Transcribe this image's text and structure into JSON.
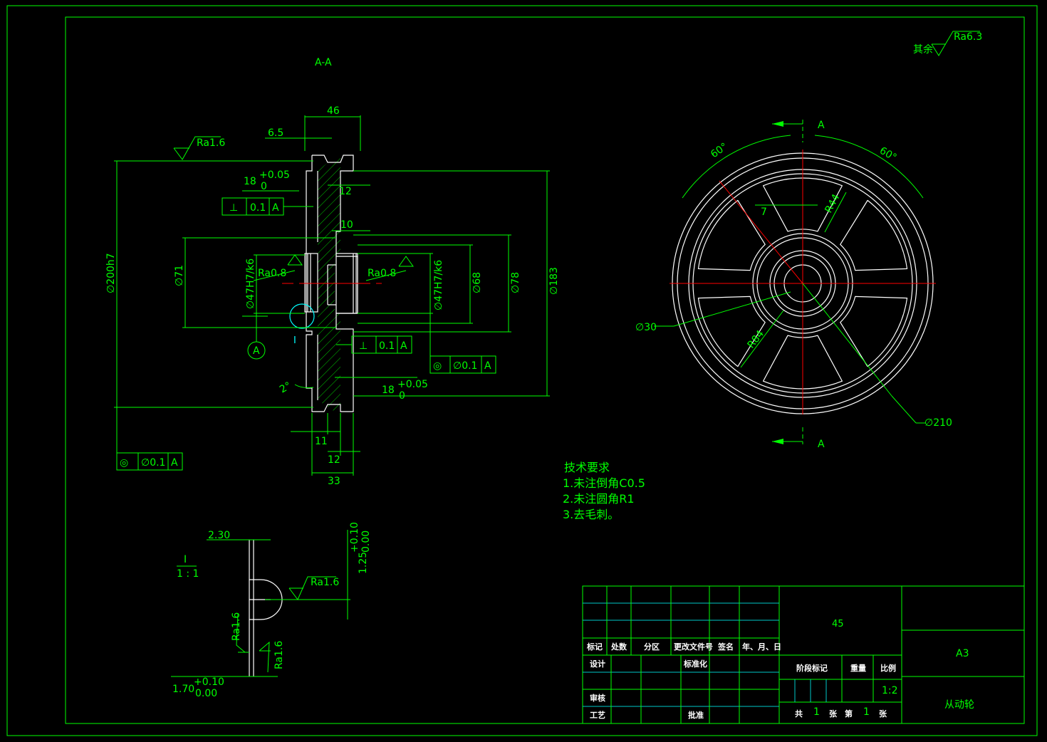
{
  "colors": {
    "line": "#00ff00",
    "outline": "#ffffff",
    "center": "#ff0000",
    "table_line": "#00c8c8",
    "detail_circle": "#00ffff"
  },
  "section": {
    "label": "A-A"
  },
  "roughness": {
    "rest_prefix": "其余",
    "rest_value": "Ra6.3",
    "top_left": "Ra1.6",
    "bore_left": "Ra0.8",
    "bore_right": "Ra0.8",
    "detail_a": "Ra1.6",
    "detail_b": "Ra1.6",
    "detail_c": "Ra1.6"
  },
  "dims": {
    "d46": "46",
    "d6_5": "6.5",
    "d18a": "18",
    "d18a_tol_up": "+0.05",
    "d18a_tol_low": "0",
    "d12a": "12",
    "d10": "10",
    "d200": "∅200h7",
    "d71": "∅71",
    "d47a": "∅47H7/k6",
    "d47b": "∅47H7/k6",
    "d68": "∅68",
    "d78": "∅78",
    "d183": "∅183",
    "d18b": "18",
    "d18b_tol_up": "+0.05",
    "d18b_tol_low": "0",
    "d11": "11",
    "d12b": "12",
    "d33": "33",
    "angle2": "2°",
    "d30": "∅30",
    "d210": "∅210",
    "r44": "R44",
    "r84": "R84",
    "d7": "7",
    "a60l": "60°",
    "a60r": "60°",
    "d2_30": "2.30",
    "d1_25": "1.25",
    "d1_25_tol_up": "+0.10",
    "d1_25_tol_low": "0.00",
    "d1_70": "1.70",
    "d1_70_tol_up": "+0.10",
    "d1_70_tol_low": "0.00"
  },
  "tolerances": {
    "perp_symbol": "⊥",
    "perp_value": "0.1",
    "perp_datum": "A",
    "perp2_symbol": "⊥",
    "perp2_value": "0.1",
    "perp2_datum": "A",
    "conc_symbol": "◎",
    "conc_value": "∅0.1",
    "conc_datum": "A",
    "conc2_symbol": "◎",
    "conc2_value": "∅0.1",
    "conc2_datum": "A"
  },
  "datum": {
    "label": "A"
  },
  "detail": {
    "marker": "I",
    "title": "I",
    "scale": "1 : 1"
  },
  "front_view": {
    "section_top": "A",
    "section_bottom": "A"
  },
  "tech_requirements": {
    "title": "技术要求",
    "items": [
      "1.未注倒角C0.5",
      "2.未注圆角R1",
      "3.去毛刺。"
    ]
  },
  "title_block": {
    "material": "45",
    "sheet_size": "A3",
    "part_name": "从动轮",
    "scale_label": "比例",
    "scale_value": "1:2",
    "stage_label": "阶段标记",
    "weight_label": "重量",
    "headers": [
      "标记",
      "处数",
      "分区",
      "更改文件号",
      "签名",
      "年、月、日"
    ],
    "design": "设计",
    "standard": "标准化",
    "review": "审核",
    "process": "工艺",
    "approve": "批准",
    "total_prefix": "共",
    "total_count": "1",
    "sheet_mid": "张",
    "sheet_label": "第",
    "sheet_num": "1",
    "sheet_suffix": "张"
  }
}
